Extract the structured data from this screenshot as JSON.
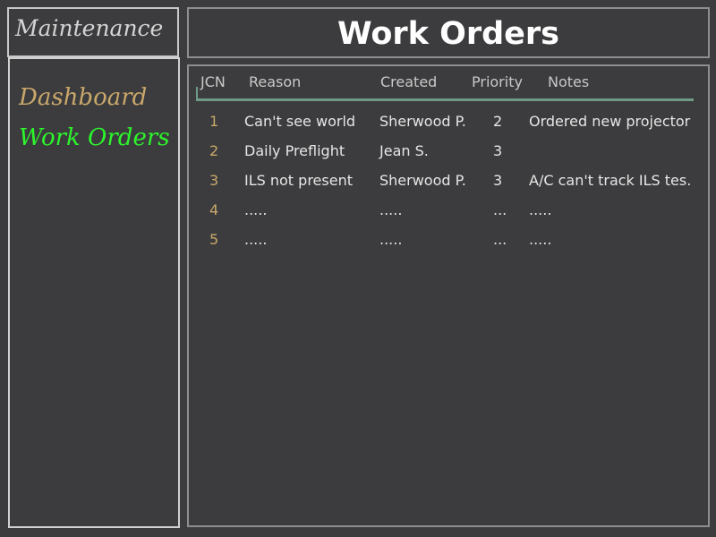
{
  "sidebar": {
    "brand": "Maintenance",
    "items": [
      {
        "label": "Dashboard"
      },
      {
        "label": "Work Orders"
      }
    ]
  },
  "header": {
    "title": "Work Orders"
  },
  "table": {
    "columns": [
      "JCN",
      "Reason",
      "Created",
      "Priority",
      "Notes"
    ],
    "rows": [
      {
        "jcn": "1",
        "reason": "Can't see world",
        "created": "Sherwood P.",
        "priority": "2",
        "notes": "Ordered new projector"
      },
      {
        "jcn": "2",
        "reason": "Daily Preflight",
        "created": "Jean S.",
        "priority": "3",
        "notes": ""
      },
      {
        "jcn": "3",
        "reason": "ILS not present",
        "created": "Sherwood P.",
        "priority": "3",
        "notes": "A/C can't track ILS tes."
      },
      {
        "jcn": "4",
        "reason": ".....",
        "created": ".....",
        "priority": "...",
        "notes": "....."
      },
      {
        "jcn": "5",
        "reason": ".....",
        "created": ".....",
        "priority": "...",
        "notes": "....."
      }
    ]
  },
  "colors": {
    "background": "#3c3c3e",
    "nav_active": "#2cf52c",
    "nav_inactive": "#c9a86a",
    "jcn_number": "#c9a86a",
    "header_rule": "#6f9a88"
  }
}
